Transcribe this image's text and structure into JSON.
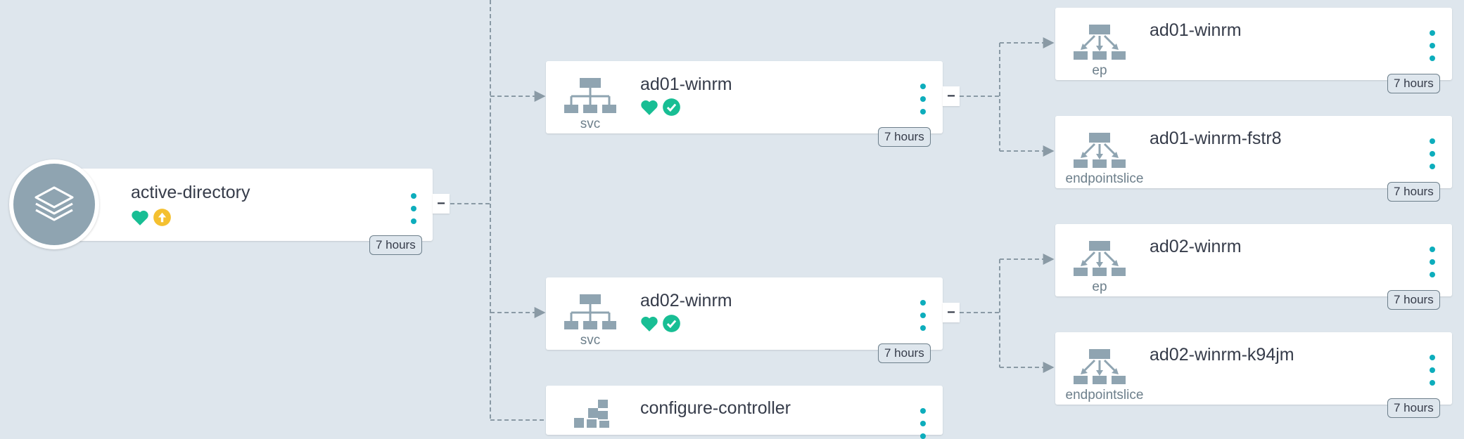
{
  "colors": {
    "background": "#dee6ed",
    "icon_gray": "#8fa4b1",
    "health_green": "#18be94",
    "progress_yellow": "#f4c030",
    "menu_teal": "#0dadbc"
  },
  "app": {
    "name": "active-directory",
    "age": "7 hours",
    "status_icons": [
      "heart-icon",
      "arrow-up-circle-icon"
    ]
  },
  "services": [
    {
      "name": "ad01-winrm",
      "kind": "svc",
      "age": "7 hours",
      "status_icons": [
        "heart-icon",
        "check-circle-icon"
      ]
    },
    {
      "name": "ad02-winrm",
      "kind": "svc",
      "age": "7 hours",
      "status_icons": [
        "heart-icon",
        "check-circle-icon"
      ]
    },
    {
      "name": "configure-controller"
    }
  ],
  "endpoints": [
    {
      "name": "ad01-winrm",
      "kind": "ep",
      "age": "7 hours"
    },
    {
      "name": "ad01-winrm-fstr8",
      "kind": "endpointslice",
      "age": "7 hours"
    },
    {
      "name": "ad02-winrm",
      "kind": "ep",
      "age": "7 hours"
    },
    {
      "name": "ad02-winrm-k94jm",
      "kind": "endpointslice",
      "age": "7 hours"
    }
  ],
  "collapse_label": "−"
}
